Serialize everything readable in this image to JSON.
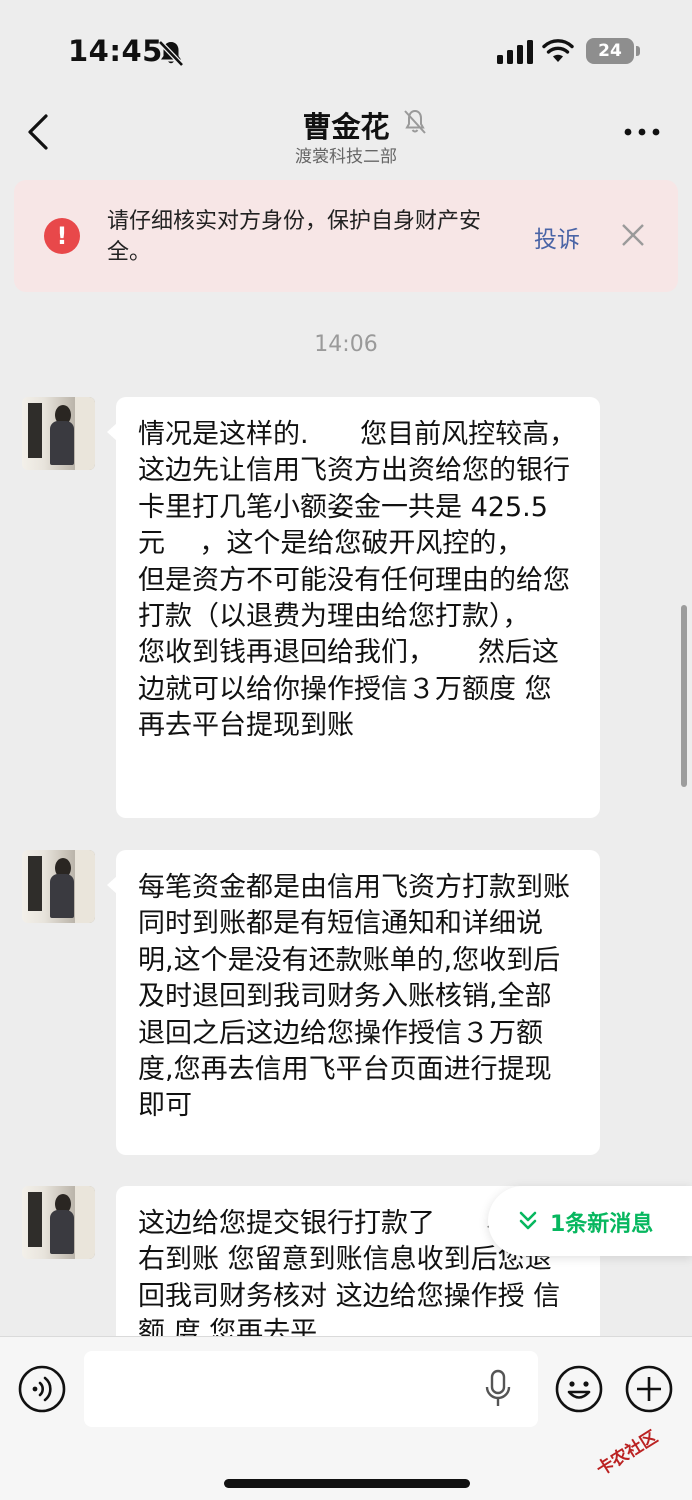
{
  "status_bar": {
    "time": "14:45",
    "battery": "24"
  },
  "header": {
    "title": "曹金花",
    "subtitle": "渡裳科技二部"
  },
  "warning": {
    "text": "请仔细核实对方身份，保护自身财产安全。",
    "action": "投诉"
  },
  "timestamp": "14:06",
  "messages": [
    {
      "text": "情况是这样的.      您目前风控较高，这边先让信用飞资方出资给您的银行卡里打几笔小额姿金一共是 425.5  元    ，这个是给您破开风控的，      但是资方不可能没有任何理由的给您打款（以退费为理由给您打款），      您收到钱再退回给我们，     然后这边就可以给你操作授信３万额度 您再去平台提现到账"
    },
    {
      "text": "每笔资金都是由信用飞资方打款到账同时到账都是有短信通知和详细说明,这个是没有还款账单的,您收到后及时退回到我司财务入账核销,全部退回之后这边给您操作授信３万额度,您再去信用飞平台页面进行提现即可"
    },
    {
      "text": "这边给您提交银行打款了      小时左右到账 您留意到账信息收到后您退回我司财务核对 这边给您操作授 信额 度 您再去平"
    }
  ],
  "new_messages": {
    "label": "1条新消息"
  },
  "input": {
    "placeholder": ""
  },
  "watermark": "卡农社区",
  "colors": {
    "accent_green": "#07b75f",
    "warning_bg": "#f7e6e6",
    "warning_red": "#e8484a",
    "link_blue": "#4a64a6"
  }
}
